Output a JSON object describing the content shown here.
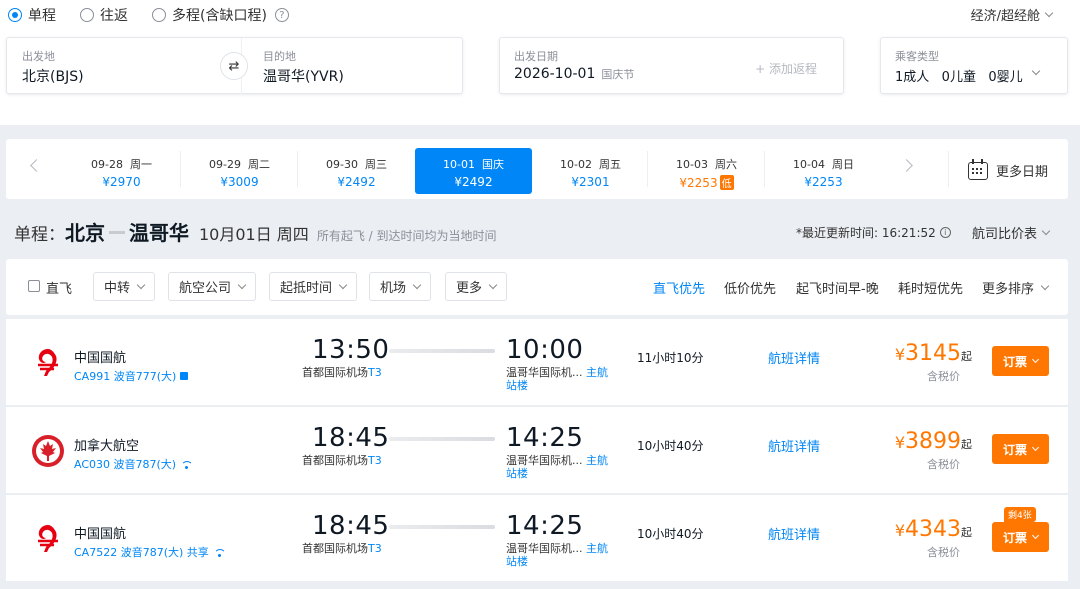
{
  "trip_types": [
    {
      "label": "单程",
      "selected": true
    },
    {
      "label": "往返",
      "selected": false
    },
    {
      "label": "多程(含缺口程)",
      "selected": false
    }
  ],
  "help_glyph": "?",
  "cabin": "经济/超经舱",
  "search": {
    "from_label": "出发地",
    "from_value": "北京(BJS)",
    "to_label": "目的地",
    "to_value": "温哥华(YVR)",
    "swap_glyph": "⇄",
    "date_label": "出发日期",
    "date_value": "2026-10-01",
    "date_holiday": "国庆节",
    "add_return": "+ 添加返程",
    "pax_label": "乘客类型",
    "pax_value": "1成人   0儿童   0婴儿"
  },
  "dates": [
    {
      "date": "09-28  周一",
      "price": "¥2970",
      "selected": false,
      "low": false
    },
    {
      "date": "09-29  周二",
      "price": "¥3009",
      "selected": false,
      "low": false
    },
    {
      "date": "09-30  周三",
      "price": "¥2492",
      "selected": false,
      "low": false
    },
    {
      "date": "10-01  国庆",
      "price": "¥2492",
      "selected": true,
      "low": false
    },
    {
      "date": "10-02  周五",
      "price": "¥2301",
      "selected": false,
      "low": false
    },
    {
      "date": "10-03  周六",
      "price": "¥2253",
      "selected": false,
      "low": true
    },
    {
      "date": "10-04  周日",
      "price": "¥2253",
      "selected": false,
      "low": false
    }
  ],
  "low_tag": "低",
  "more_dates": "更多日期",
  "route": {
    "trip": "单程：",
    "from": "北京",
    "to": "温哥华",
    "date": "10月01日 周四",
    "note": "所有起飞 / 到达时间均为当地时间",
    "update_time": "*最近更新时间: 16:21:52",
    "info_glyph": "i",
    "compare": "航司比价表"
  },
  "filters": {
    "direct": "直飞",
    "buttons": [
      "中转",
      "航空公司",
      "起抵时间",
      "机场",
      "更多"
    ],
    "sorts": [
      "直飞优先",
      "低价优先",
      "起飞时间早-晚",
      "耗时短优先",
      "更多排序"
    ]
  },
  "flights": [
    {
      "airline": "中国国航",
      "flight_no": "CA991 波音777(大)",
      "dep_time": "13:50",
      "dep_airport": "首都国际机场",
      "dep_terminal": "T3",
      "arr_time": "10:00",
      "arr_airport": "温哥华国际机...",
      "arr_terminal": "主航站楼",
      "duration": "11小时10分",
      "detail": "航班详情",
      "currency": "¥",
      "price": "3145",
      "qi": "起",
      "tax": "含税价",
      "book": "订票",
      "remain": ""
    },
    {
      "airline": "加拿大航空",
      "flight_no": "AC030 波音787(大)",
      "dep_time": "18:45",
      "dep_airport": "首都国际机场",
      "dep_terminal": "T3",
      "arr_time": "14:25",
      "arr_airport": "温哥华国际机...",
      "arr_terminal": "主航站楼",
      "duration": "10小时40分",
      "detail": "航班详情",
      "currency": "¥",
      "price": "3899",
      "qi": "起",
      "tax": "含税价",
      "book": "订票",
      "remain": ""
    },
    {
      "airline": "中国国航",
      "flight_no": "CA7522 波音787(大) 共享",
      "dep_time": "18:45",
      "dep_airport": "首都国际机场",
      "dep_terminal": "T3",
      "arr_time": "14:25",
      "arr_airport": "温哥华国际机...",
      "arr_terminal": "主航站楼",
      "duration": "10小时40分",
      "detail": "航班详情",
      "currency": "¥",
      "price": "4343",
      "qi": "起",
      "tax": "含税价",
      "book": "订票",
      "remain": "剩4张"
    }
  ],
  "colors": {
    "accent": "#0086f6",
    "price": "#ff7700",
    "air_china": "#e60012",
    "air_canada": "#d8202a"
  }
}
